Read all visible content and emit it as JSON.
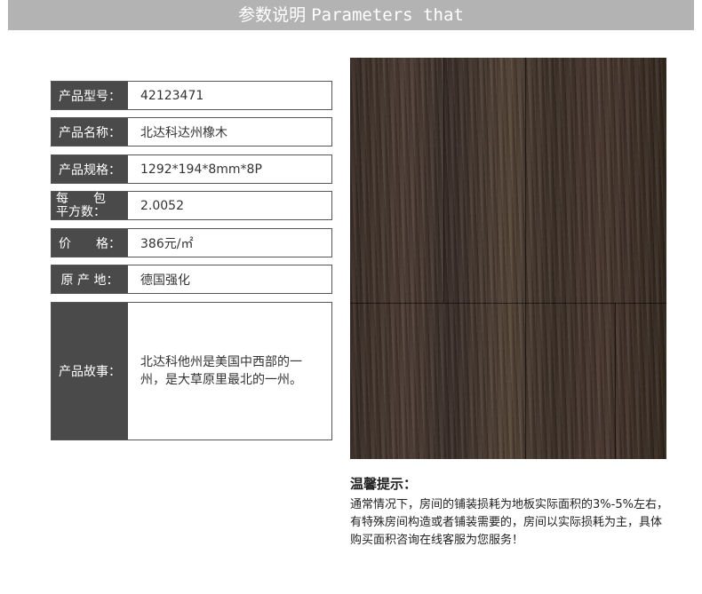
{
  "header": {
    "title_cn": "参数说明",
    "title_en": "Parameters that"
  },
  "params": [
    {
      "label": "产品型号：",
      "value": "42123471"
    },
    {
      "label": "产品名称：",
      "value": "北达科达州橡木"
    },
    {
      "label": "产品规格：",
      "value": "1292*194*8mm*8P"
    },
    {
      "label_line1": "每　　包",
      "label_line2": "平方数：",
      "value": "2.0052"
    },
    {
      "label": "价　　格：",
      "value": "386元/㎡"
    },
    {
      "label": "原 产 地：",
      "value": "德国强化"
    }
  ],
  "story": {
    "label": "产品故事：",
    "value": "北达科他州是美国中西部的一州，是大草原里最北的一州。"
  },
  "tips": {
    "title": "温馨提示：",
    "body": "通常情况下，房间的铺装损耗为地板实际面积的3%-5%左右，有特殊房间构造或者铺装需要的，房间以实际损耗为主，具体购买面积咨询在线客服为您服务！"
  }
}
